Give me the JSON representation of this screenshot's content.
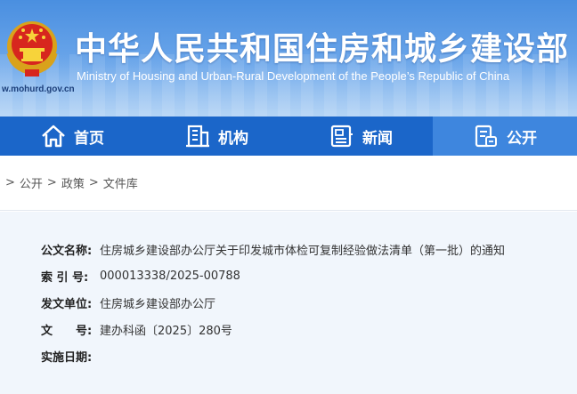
{
  "header": {
    "cn_title": "中华人民共和国住房和城乡建设部",
    "en_title": "Ministry of Housing and Urban-Rural Development of the People’s Republic of China",
    "site_url": "w.mohurd.gov.cn"
  },
  "nav": {
    "items": [
      {
        "label": "首页",
        "icon": "home-icon"
      },
      {
        "label": "机构",
        "icon": "building-icon"
      },
      {
        "label": "新闻",
        "icon": "news-icon"
      },
      {
        "label": "公开",
        "icon": "document-icon",
        "active": true
      }
    ]
  },
  "breadcrumb": {
    "items": [
      "公开",
      "政策",
      "文件库"
    ],
    "separator": ">"
  },
  "info": {
    "rows": [
      {
        "label": "公文名称:",
        "value": "住房城乡建设部办公厅关于印发城市体检可复制经验做法清单（第一批）的通知"
      },
      {
        "label": "索 引 号:",
        "value": "000013338/2025-00788"
      },
      {
        "label": "发文单位:",
        "value": "住房城乡建设部办公厅"
      },
      {
        "label": "文　　号:",
        "value": "建办科函〔2025〕280号"
      },
      {
        "label": "实施日期:",
        "value": ""
      }
    ]
  },
  "colors": {
    "nav_bg": "#1b66c9",
    "nav_active": "#3e86de",
    "panel_bg": "#f1f6fc"
  }
}
